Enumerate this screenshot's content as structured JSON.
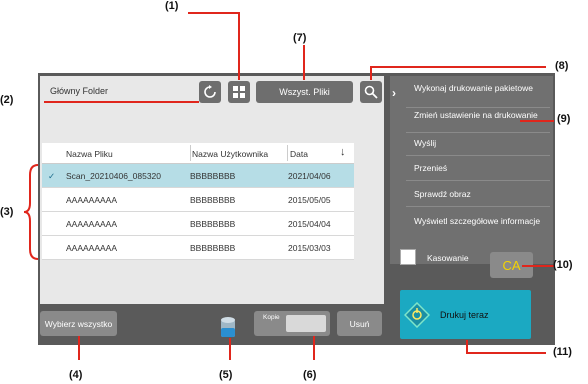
{
  "folder": {
    "label": "Główny Folder"
  },
  "toolbar": {
    "all_files_label": "Wszyst. Pliki"
  },
  "table": {
    "headers": [
      "Nazwa Pliku",
      "Nazwa Użytkownika",
      "Data"
    ],
    "rows": [
      {
        "name": "Scan_20210406_085320",
        "user": "BBBBBBBB",
        "date": "2021/04/06",
        "selected": true
      },
      {
        "name": "AAAAAAAAA",
        "user": "BBBBBBBB",
        "date": "2015/05/05",
        "selected": false
      },
      {
        "name": "AAAAAAAAA",
        "user": "BBBBBBBB",
        "date": "2015/04/04",
        "selected": false
      },
      {
        "name": "AAAAAAAAA",
        "user": "BBBBBBBB",
        "date": "2015/03/03",
        "selected": false
      }
    ]
  },
  "bottom": {
    "select_all_label": "Wybierz wszystko",
    "copies_label": "Kopie",
    "delete_label": "Usuń"
  },
  "menu": {
    "items": [
      "Wykonaj drukowanie pakietowe",
      "Zmień ustawienie na drukowanie",
      "Wyślij",
      "Przenieś",
      "Sprawdź obraz",
      "Wyświetl szczegółowe informacje"
    ]
  },
  "erase": {
    "label": "Kasowanie"
  },
  "ca_label": "CA",
  "print_now_label": "Drukuj teraz",
  "callouts": [
    "(1)",
    "(2)",
    "(3)",
    "(4)",
    "(5)",
    "(6)",
    "(7)",
    "(8)",
    "(9)",
    "(10)",
    "(11)"
  ],
  "colors": {
    "accent": "#1ba9c2",
    "callout_line": "#e0261c",
    "ca_text": "#f5d300",
    "selected_row": "#b6dde6"
  }
}
